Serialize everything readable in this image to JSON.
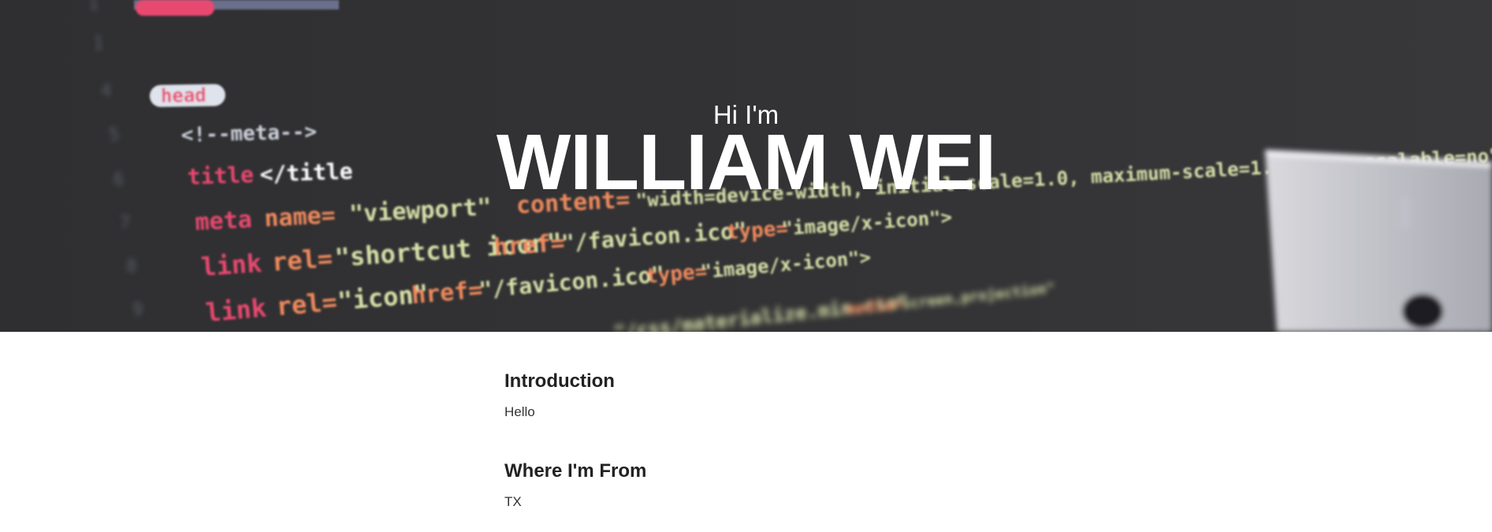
{
  "hero": {
    "greeting": "Hi I'm",
    "name": "WILLIAM WEI",
    "code_lines": {
      "head": "head",
      "comment": "<!--meta-->",
      "title_open": "title",
      "title_close": "</title",
      "meta_tag": "meta",
      "meta_attr": "name=",
      "meta_value": "\"viewport\"",
      "content_attr": "content=",
      "content_value": "\"width=device-width, initial-scale=1.0, maximum-scale=1.0, user-scalable=no\"",
      "link_tag": "link",
      "rel_attr": "rel=",
      "shortcut_value": "\"shortcut icon\"",
      "href_attr": "href=",
      "favicon_value": "\"/favicon.ico\"",
      "type_attr": "type=",
      "type_value": "\"image/x-icon\">",
      "icon_value": "\"icon\"",
      "css_value": "\"/css/materialize.min.css\"",
      "media_attr": "media=",
      "media_value": "\"screen,projection\""
    },
    "colors": {
      "background": "#333335",
      "tag": "#e84a6f",
      "attr": "#f08a5d",
      "string": "#d8e0a8"
    }
  },
  "sections": [
    {
      "title": "Introduction",
      "body": "Hello"
    },
    {
      "title": "Where I'm From",
      "body": "TX"
    }
  ]
}
